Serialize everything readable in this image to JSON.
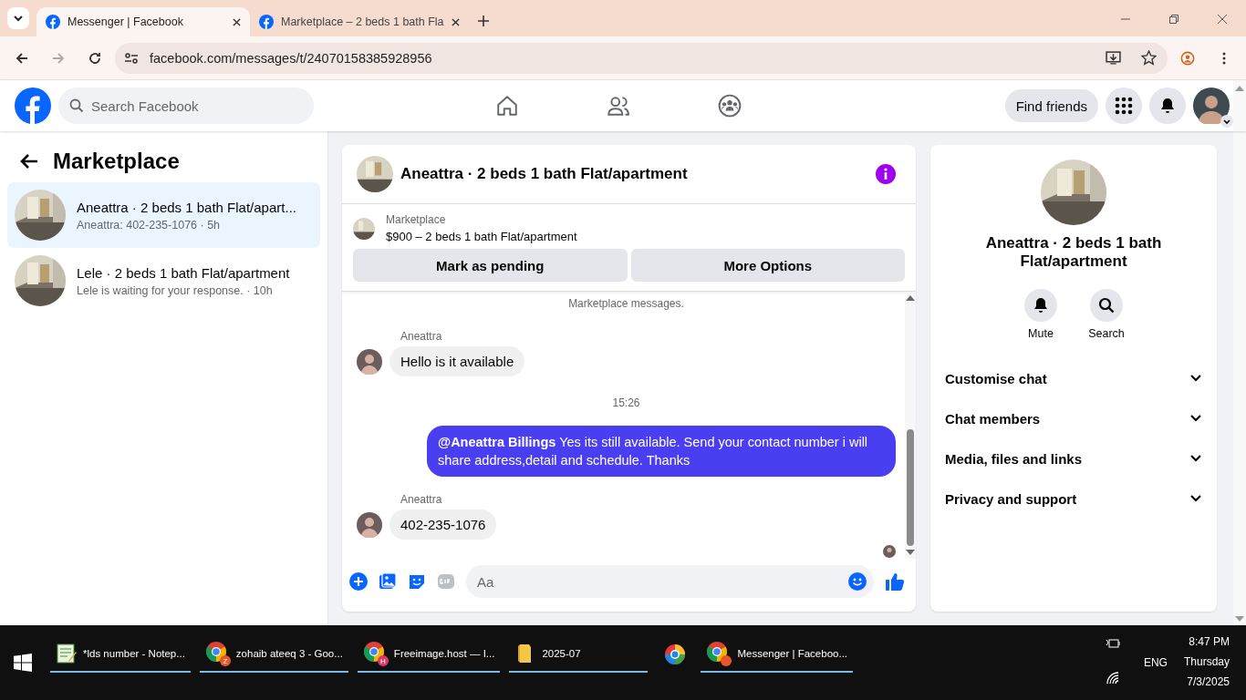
{
  "browser": {
    "tabs": [
      {
        "title": "Messenger | Facebook",
        "selected": true
      },
      {
        "title": "Marketplace – 2 beds 1 bath Fla",
        "selected": false
      }
    ],
    "url": "facebook.com/messages/t/24070158385928956"
  },
  "header": {
    "search_placeholder": "Search Facebook",
    "find_friends": "Find friends"
  },
  "sidebar": {
    "title": "Marketplace",
    "chats": [
      {
        "name": "Aneattra · 2 beds 1 bath Flat/apart...",
        "preview": "Aneattra: 402-235-1076 · 5h",
        "selected": true
      },
      {
        "name": "Lele · 2 beds 1 bath Flat/apartment",
        "preview": "Lele is waiting for your response. · 10h",
        "selected": false
      }
    ]
  },
  "chat": {
    "title": "Aneattra · 2 beds 1 bath Flat/apartment",
    "listing": {
      "label": "Marketplace",
      "title": "$900 – 2 beds 1 bath Flat/apartment"
    },
    "actions": [
      "Mark as pending",
      "More Options"
    ],
    "notice": "Marketplace messages.",
    "messages": [
      {
        "kind": "incoming",
        "sender": "Aneattra",
        "text": "Hello is it available"
      },
      {
        "kind": "time",
        "text": "15:26"
      },
      {
        "kind": "outgoing",
        "text": "**@Aneattra Billings**  Yes its still available. Send your contact number i will share address,detail and schedule. Thanks"
      },
      {
        "kind": "incoming",
        "sender": "Aneattra",
        "text": "402-235-1076"
      }
    ],
    "composer_placeholder": "Aa"
  },
  "details": {
    "title": "Aneattra · 2 beds 1 bath Flat/apartment",
    "actions": [
      {
        "kind": "mute",
        "label": "Mute"
      },
      {
        "kind": "search",
        "label": "Search"
      }
    ],
    "sections": [
      {
        "label": "Customise chat",
        "expanded": false
      },
      {
        "label": "Chat members",
        "expanded": false
      },
      {
        "label": "Media, files and links",
        "expanded": false
      },
      {
        "label": "Privacy and support",
        "expanded": false
      }
    ]
  },
  "taskbar": {
    "apps": [
      {
        "kind": "notepad",
        "label": "*lds number - Notep..."
      },
      {
        "kind": "chrome",
        "label": "zohaib ateeq 3 - Goo...",
        "badge": "Z",
        "color": "#e8562a"
      },
      {
        "kind": "chrome",
        "label": "Freeimage.host — I...",
        "badge": "H",
        "color": "#d9386b"
      },
      {
        "kind": "folder",
        "label": "2025-07"
      },
      {
        "kind": "app"
      },
      {
        "kind": "chrome",
        "label": "Messenger | Faceboo...",
        "color": "#e8562a"
      }
    ],
    "language": "ENG",
    "time": "8:47 PM",
    "day": "Thursday",
    "date": "7/3/2025"
  }
}
